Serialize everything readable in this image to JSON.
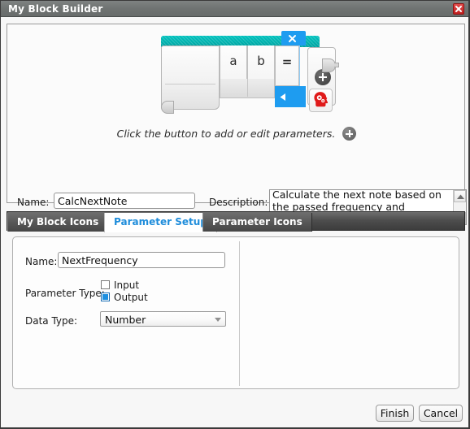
{
  "window": {
    "title": "My Block Builder",
    "close_icon": "close-x-icon"
  },
  "preview": {
    "block_icon": "brain-gears-icon",
    "slot_labels": [
      "a",
      "b"
    ],
    "selected_slot_label": "=",
    "selected_close_icon": "close-x-icon",
    "selected_collapse_icon": "triangle-left-icon",
    "add_parameter_icon": "plus-circle-icon",
    "left_plug_icon": "input-plug-icon",
    "right_plug_icon": "output-plug-icon",
    "header_color": "#00a3a0",
    "selection_color": "#1e9cf0"
  },
  "hint": {
    "text": "Click the button to add or edit parameters.",
    "button_icon": "plus-circle-icon"
  },
  "meta": {
    "name_label": "Name:",
    "name_value": "CalcNextNote",
    "description_label": "Description:",
    "description_value": "Calculate the next note based on\nthe passed frequency and number\nof half steps",
    "scroll_up_icon": "triangle-up-icon",
    "scroll_down_icon": "triangle-down-icon"
  },
  "tabs": [
    {
      "label": "My Block Icons",
      "active": false
    },
    {
      "label": "Parameter Setup",
      "active": true
    },
    {
      "label": "Parameter Icons",
      "active": false
    }
  ],
  "parameter_setup": {
    "name_label": "Name:",
    "name_value": "NextFrequency",
    "parameter_type_label": "Parameter Type:",
    "type_options": [
      {
        "label": "Input",
        "checked": false
      },
      {
        "label": "Output",
        "checked": true
      }
    ],
    "data_type_label": "Data Type:",
    "data_type_value": "Number",
    "dropdown_icon": "chevron-down-icon"
  },
  "footer": {
    "finish_label": "Finish",
    "cancel_label": "Cancel"
  }
}
